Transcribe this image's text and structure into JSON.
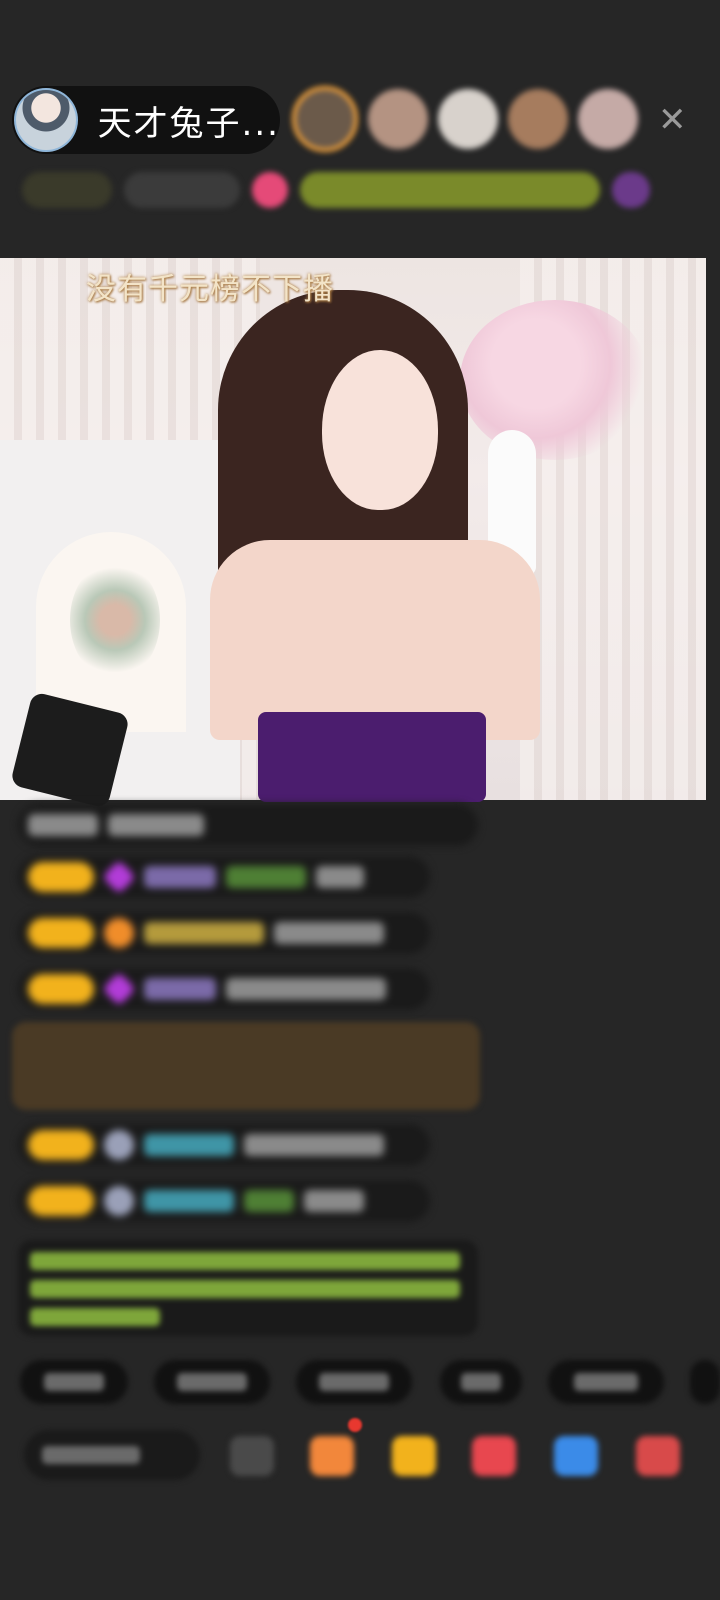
{
  "host": {
    "name": "天才兔子..."
  },
  "header": {
    "close_icon": "close-icon",
    "viewer_count_shown": 5
  },
  "video": {
    "banner": "没有千元榜不下播"
  },
  "colors": {
    "background": "#262626",
    "level_badge": "#f2b21c",
    "banner_text": "#f3e4c8",
    "accent_pink": "#e54a78"
  },
  "chat": {
    "visible_messages": 8
  },
  "quick_replies": {
    "count": 6
  },
  "toolbar": {
    "icons": [
      "chat-icon",
      "gift-icon",
      "treasure-icon",
      "like-icon",
      "game-icon",
      "more-icon"
    ]
  }
}
